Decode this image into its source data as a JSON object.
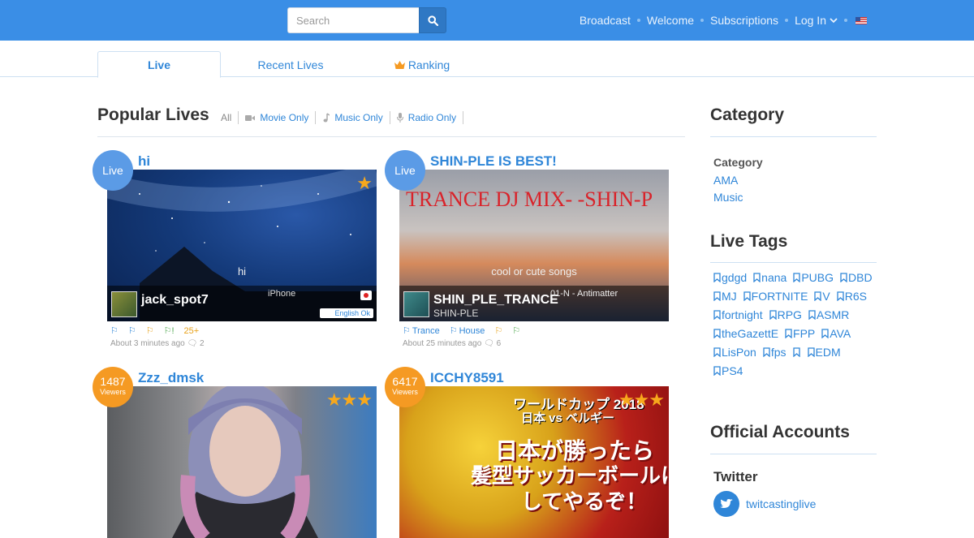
{
  "header": {
    "search_placeholder": "Search",
    "nav": [
      "Broadcast",
      "Welcome",
      "Subscriptions"
    ],
    "login": "Log In"
  },
  "tabs": {
    "live": "Live",
    "recent": "Recent Lives",
    "ranking": "Ranking"
  },
  "main": {
    "title": "Popular Lives",
    "filters": {
      "all": "All",
      "movie": "Movie Only",
      "music": "Music Only",
      "radio": "Radio Only"
    }
  },
  "cards": [
    {
      "badge": "Live",
      "title": "hi",
      "caption": "hi",
      "user": "jack_spot7",
      "device": "iPhone",
      "lang": "English Ok",
      "tags_extra": "25+",
      "meta": "About 3 minutes ago",
      "comments": "2"
    },
    {
      "badge": "Live",
      "title": "SHIN-PLE IS BEST!",
      "caption": "cool or cute songs",
      "banner": "TRANCE DJ MIX- -SHIN-P",
      "user": "SHIN_PLE_TRANCE",
      "sub": "SHIN-PLE",
      "track": "01-N - Antimatter",
      "tag1": "Trance",
      "tag2": "House",
      "meta": "About 25 minutes ago",
      "comments": "6"
    },
    {
      "viewers": "1487",
      "viewers_label": "Viewers",
      "title": "Zzz_dmsk"
    },
    {
      "viewers": "6417",
      "viewers_label": "Viewers",
      "title": "ICCHY8591",
      "banner1": "ワールドカップ 2018",
      "banner2": "日本 vs ベルギー",
      "banner3": "日本が勝ったら",
      "banner4": "髪型サッカーボールに",
      "banner5": "してやるぞ！"
    }
  ],
  "sidebar": {
    "category_title": "Category",
    "category_sub": "Category",
    "categories": [
      "AMA",
      "Music"
    ],
    "tags_title": "Live Tags",
    "tags": [
      "gdgd",
      "nana",
      "PUBG",
      "DBD",
      "MJ",
      "FORTNITE",
      "V",
      "R6S",
      "fortnight",
      "RPG",
      "ASMR",
      "theGazettE",
      "FPP",
      "AVA",
      "LisPon",
      "fps",
      "",
      "EDM",
      "PS4"
    ],
    "official_title": "Official Accounts",
    "twitter_label": "Twitter",
    "twitter_handle": "twitcastinglive"
  },
  "colors": {
    "header": "#3a8ee6",
    "link": "#2f86d8",
    "live_badge": "#5b9be6",
    "viewers_badge": "#f59a23",
    "star": "#f7a81c"
  }
}
